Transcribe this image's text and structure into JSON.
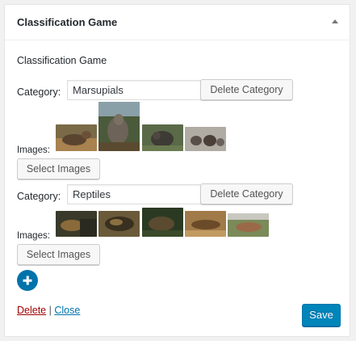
{
  "widget": {
    "title": "Classification Game",
    "game_label": "Classification Game"
  },
  "categories": [
    {
      "label": "Category:",
      "value": "Marsupials",
      "delete_label": "Delete Category",
      "images_label": "Images:",
      "select_label": "Select Images",
      "images": [
        "marsupial-image-1",
        "marsupial-image-2",
        "marsupial-image-3",
        "marsupial-image-4"
      ]
    },
    {
      "label": "Category:",
      "value": "Reptiles",
      "delete_label": "Delete Category",
      "images_label": "Images:",
      "select_label": "Select Images",
      "images": [
        "reptile-image-1",
        "reptile-image-2",
        "reptile-image-3",
        "reptile-image-4",
        "reptile-image-5"
      ]
    }
  ],
  "add_category": {
    "icon": "plus-circle-icon"
  },
  "footer": {
    "delete_label": "Delete",
    "separator": "|",
    "close_label": "Close",
    "save_label": "Save"
  },
  "colors": {
    "accent": "#0085ba",
    "add_button": "#0073aa",
    "delete_link": "#a00000",
    "link": "#0073aa"
  }
}
